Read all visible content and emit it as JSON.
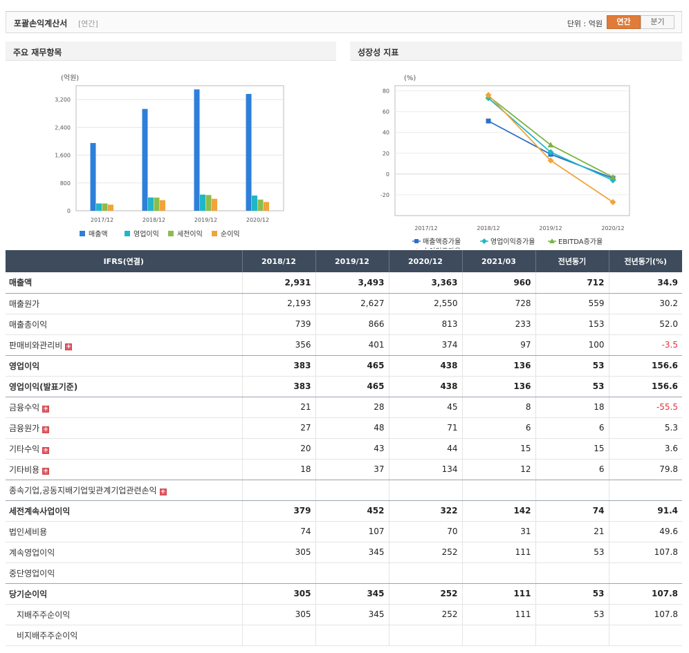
{
  "header": {
    "title": "포괄손익계산서",
    "period_tag": "[연간]",
    "unit_label": "단위 : 억원",
    "toggle_annual": "연간",
    "toggle_quarter": "분기"
  },
  "bar_panel": {
    "title": "주요 재무항목",
    "unit": "(억원)",
    "legend": [
      "매출액",
      "영업이익",
      "세전이익",
      "순이익"
    ]
  },
  "line_panel": {
    "title": "성장성 지표",
    "unit": "(%)",
    "legend": [
      "매출액증가율",
      "영업이익증가율",
      "EBITDA증가율",
      "순이익증가율"
    ]
  },
  "chart_data": [
    {
      "type": "bar",
      "categories": [
        "2017/12",
        "2018/12",
        "2019/12",
        "2020/12"
      ],
      "ylim": [
        0,
        3600
      ],
      "yticks": [
        0,
        800,
        1600,
        2400,
        3200
      ],
      "ytick_labels": [
        "0",
        "800",
        "1,600",
        "2,400",
        "3,200"
      ],
      "series": [
        {
          "name": "매출액",
          "color": "#2e7fd9",
          "values": [
            1950,
            2931,
            3493,
            3363
          ]
        },
        {
          "name": "영업이익",
          "color": "#20b6c6",
          "values": [
            210,
            383,
            465,
            438
          ]
        },
        {
          "name": "세전이익",
          "color": "#8cbc4e",
          "values": [
            210,
            379,
            452,
            322
          ]
        },
        {
          "name": "순이익",
          "color": "#f0a43a",
          "values": [
            175,
            305,
            345,
            252
          ]
        }
      ],
      "grid": true,
      "legend_position": "bottom"
    },
    {
      "type": "line",
      "categories": [
        "2017/12",
        "2018/12",
        "2019/12",
        "2020/12"
      ],
      "ylim": [
        -40,
        85
      ],
      "yticks": [
        -20,
        0,
        20,
        40,
        60,
        80
      ],
      "series": [
        {
          "name": "매출액증가율",
          "color": "#2e6fc4",
          "marker": "square",
          "values": [
            null,
            51,
            19,
            -4
          ]
        },
        {
          "name": "영업이익증가율",
          "color": "#20b6c6",
          "marker": "diamond",
          "values": [
            null,
            73,
            21,
            -6
          ]
        },
        {
          "name": "EBITDA증가율",
          "color": "#7cb342",
          "marker": "triangle",
          "values": [
            null,
            75,
            28,
            -3
          ]
        },
        {
          "name": "순이익증가율",
          "color": "#f0a43a",
          "marker": "diamond",
          "values": [
            null,
            76,
            13,
            -27
          ]
        }
      ],
      "grid": true,
      "legend_position": "bottom"
    }
  ],
  "table": {
    "columns": [
      "IFRS(연결)",
      "2018/12",
      "2019/12",
      "2020/12",
      "2021/03",
      "전년동기",
      "전년동기(%)"
    ],
    "rows": [
      {
        "label": "매출액",
        "bold": true,
        "sep": true,
        "values": [
          "2,931",
          "3,493",
          "3,363",
          "960",
          "712",
          "34.9"
        ]
      },
      {
        "label": "매출원가",
        "values": [
          "2,193",
          "2,627",
          "2,550",
          "728",
          "559",
          "30.2"
        ]
      },
      {
        "label": "매출총이익",
        "values": [
          "739",
          "866",
          "813",
          "233",
          "153",
          "52.0"
        ]
      },
      {
        "label": "판매비와관리비",
        "plus": true,
        "sep": true,
        "values": [
          "356",
          "401",
          "374",
          "97",
          "100",
          "-3.5"
        ]
      },
      {
        "label": "영업이익",
        "bold": true,
        "values": [
          "383",
          "465",
          "438",
          "136",
          "53",
          "156.6"
        ]
      },
      {
        "label": "영업이익(발표기준)",
        "bold": true,
        "sep": true,
        "values": [
          "383",
          "465",
          "438",
          "136",
          "53",
          "156.6"
        ]
      },
      {
        "label": "금융수익",
        "plus": true,
        "values": [
          "21",
          "28",
          "45",
          "8",
          "18",
          "-55.5"
        ]
      },
      {
        "label": "금융원가",
        "plus": true,
        "values": [
          "27",
          "48",
          "71",
          "6",
          "6",
          "5.3"
        ]
      },
      {
        "label": "기타수익",
        "plus": true,
        "values": [
          "20",
          "43",
          "44",
          "15",
          "15",
          "3.6"
        ]
      },
      {
        "label": "기타비용",
        "plus": true,
        "sep": true,
        "values": [
          "18",
          "37",
          "134",
          "12",
          "6",
          "79.8"
        ]
      },
      {
        "label": "종속기업,공동지배기업및관계기업관련손익",
        "plus": true,
        "sep": true,
        "values": [
          "",
          "",
          "",
          "",
          "",
          ""
        ]
      },
      {
        "label": "세전계속사업이익",
        "bold": true,
        "values": [
          "379",
          "452",
          "322",
          "142",
          "74",
          "91.4"
        ]
      },
      {
        "label": "법인세비용",
        "values": [
          "74",
          "107",
          "70",
          "31",
          "21",
          "49.6"
        ]
      },
      {
        "label": "계속영업이익",
        "values": [
          "305",
          "345",
          "252",
          "111",
          "53",
          "107.8"
        ]
      },
      {
        "label": "중단영업이익",
        "sep": true,
        "values": [
          "",
          "",
          "",
          "",
          "",
          ""
        ]
      },
      {
        "label": "당기순이익",
        "bold": true,
        "values": [
          "305",
          "345",
          "252",
          "111",
          "53",
          "107.8"
        ]
      },
      {
        "label": "지배주주순이익",
        "indent": true,
        "values": [
          "305",
          "345",
          "252",
          "111",
          "53",
          "107.8"
        ]
      },
      {
        "label": "비지배주주순이익",
        "indent": true,
        "values": [
          "",
          "",
          "",
          "",
          "",
          ""
        ]
      }
    ]
  }
}
